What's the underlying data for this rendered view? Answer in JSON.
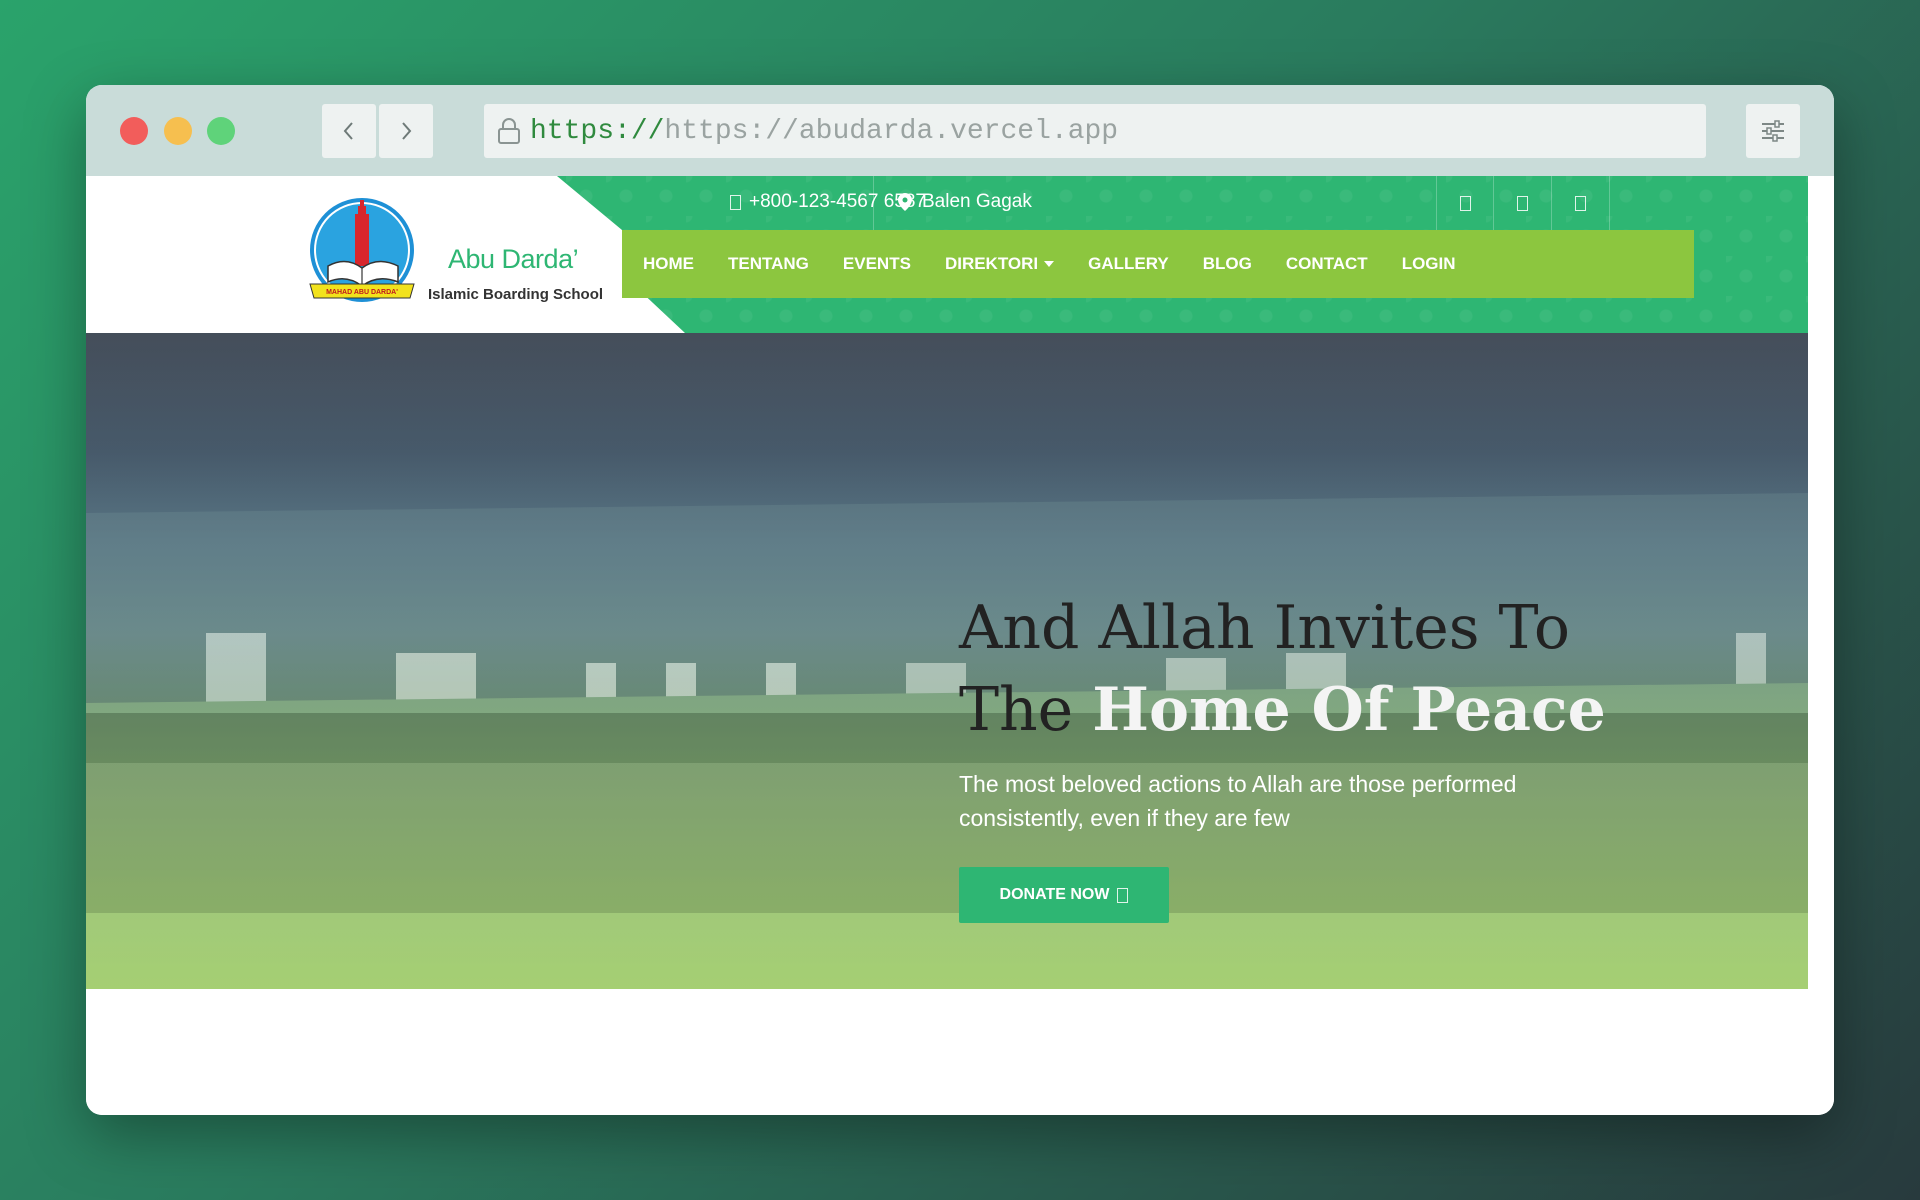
{
  "browser": {
    "url_scheme": "https://",
    "url_text": "https://abudarda.vercel.app"
  },
  "site": {
    "brand_name": "Abu Darda’",
    "brand_subtitle": "Islamic Boarding School",
    "logo_caption": "MAHAD ABU DARDA'",
    "phone": "+800-123-4567 6587",
    "location": "Balen Gagak",
    "nav": [
      {
        "label": "HOME"
      },
      {
        "label": "TENTANG"
      },
      {
        "label": "EVENTS"
      },
      {
        "label": "DIREKTORI"
      },
      {
        "label": "GALLERY"
      },
      {
        "label": "BLOG"
      },
      {
        "label": "CONTACT"
      },
      {
        "label": "LOGIN"
      }
    ]
  },
  "hero": {
    "line1": "And Allah Invites To",
    "line2_dark": "The",
    "line2_light": "Home Of Peace",
    "subtitle": "The most beloved actions to Allah are those performed consistently, even if they are few",
    "button_label": "DONATE NOW"
  },
  "colors": {
    "brand_green": "#2eb673",
    "nav_lime": "#8cc63f"
  }
}
